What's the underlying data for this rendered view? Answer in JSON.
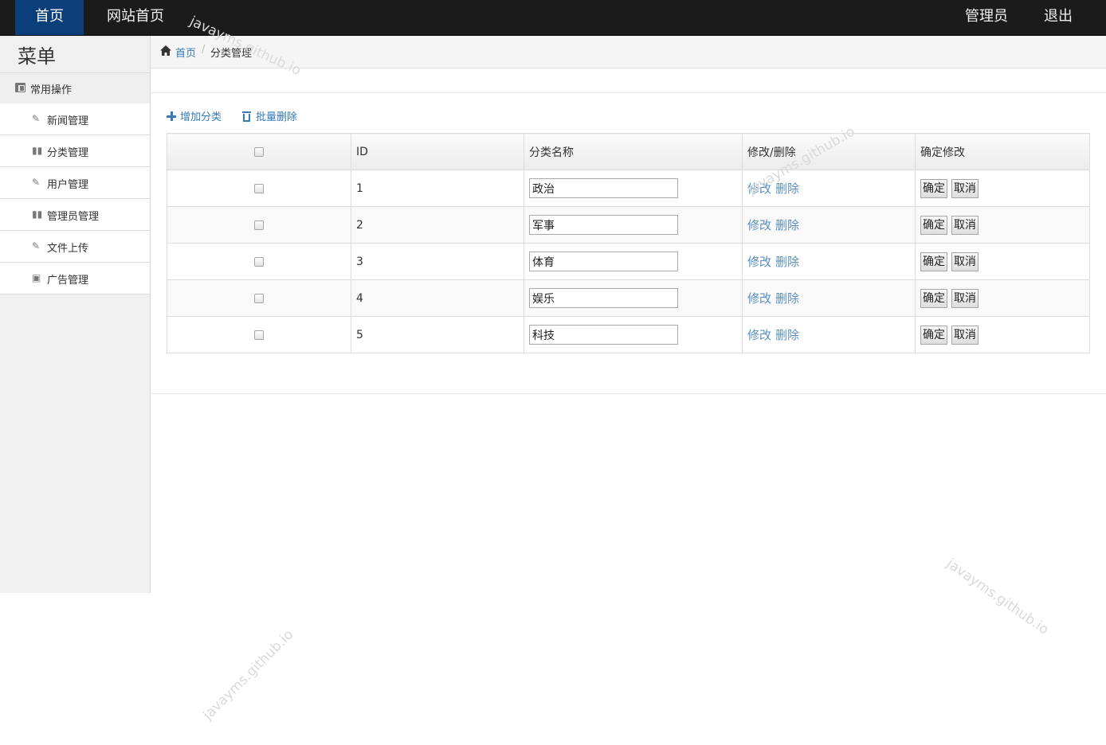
{
  "nav": {
    "home": "首页",
    "site_home": "网站首页",
    "admin": "管理员",
    "logout": "退出"
  },
  "sidebar": {
    "title": "菜单",
    "section": "常用操作",
    "items": [
      {
        "label": "新闻管理",
        "icon": "wrench-icon"
      },
      {
        "label": "分类管理",
        "icon": "books-icon"
      },
      {
        "label": "用户管理",
        "icon": "wrench-icon"
      },
      {
        "label": "管理员管理",
        "icon": "books-icon"
      },
      {
        "label": "文件上传",
        "icon": "wrench-icon"
      },
      {
        "label": "广告管理",
        "icon": "picture-icon"
      }
    ]
  },
  "breadcrumb": {
    "home": "首页",
    "separator": "/",
    "current": "分类管理"
  },
  "toolbar": {
    "add": "增加分类",
    "batch_delete": "批量删除"
  },
  "table": {
    "headers": [
      "ID",
      "分类名称",
      "修改/删除",
      "确定修改"
    ],
    "rows": [
      {
        "id": "1",
        "name": "政治"
      },
      {
        "id": "2",
        "name": "军事"
      },
      {
        "id": "3",
        "name": "体育"
      },
      {
        "id": "4",
        "name": "娱乐"
      },
      {
        "id": "5",
        "name": "科技"
      }
    ],
    "edit_label": "修改",
    "delete_label": "删除",
    "confirm_label": "确定",
    "cancel_label": "取消"
  },
  "watermark": "javayms.github.io",
  "colors": {
    "navbar": "#1b1b1b",
    "nav_active": "#0c3f7a",
    "link": "#337ab7"
  }
}
